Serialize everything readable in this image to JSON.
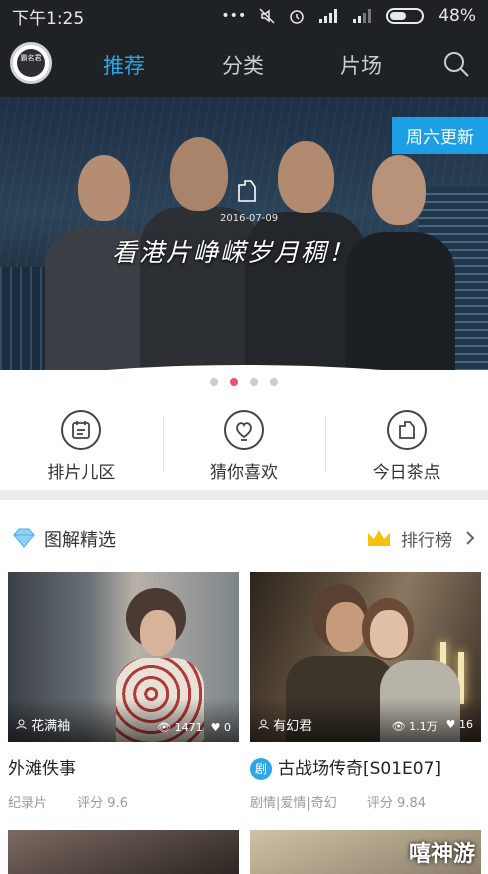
{
  "status_bar": {
    "time": "下午1:25",
    "battery_pct": "48%",
    "battery_level": 0.48
  },
  "header": {
    "logo_text": "霸名君",
    "tabs": [
      {
        "label": "推荐",
        "active": true
      },
      {
        "label": "分类",
        "active": false
      },
      {
        "label": "片场",
        "active": false
      }
    ]
  },
  "banner": {
    "badge": "周六更新",
    "date": "2016-07-09",
    "caption": "看港片峥嵘岁月稠！",
    "dots": 4,
    "active_dot": 1
  },
  "quick_menu": [
    {
      "label": "排片儿区",
      "icon": "calendar-icon"
    },
    {
      "label": "猜你喜欢",
      "icon": "heart-bulb-icon"
    },
    {
      "label": "今日茶点",
      "icon": "tea-icon"
    }
  ],
  "section": {
    "title": "图解精选",
    "ranking_label": "排行榜"
  },
  "cards": [
    {
      "author": "花满袖",
      "views": "1471",
      "likes": "0",
      "title": "外滩佚事",
      "tags": "纪录片",
      "score": "评分 9.6",
      "badge": ""
    },
    {
      "author": "有幻君",
      "views": "1.1万",
      "likes": "16",
      "title": "古战场传奇[S01E07]",
      "tags": "剧情|爱情|奇幻",
      "score": "评分 9.84",
      "badge": "剧"
    }
  ],
  "watermark": "嘻神游",
  "colors": {
    "accent": "#2ea7e6",
    "topbar": "#1f2225",
    "dot_active": "#f0506e"
  }
}
